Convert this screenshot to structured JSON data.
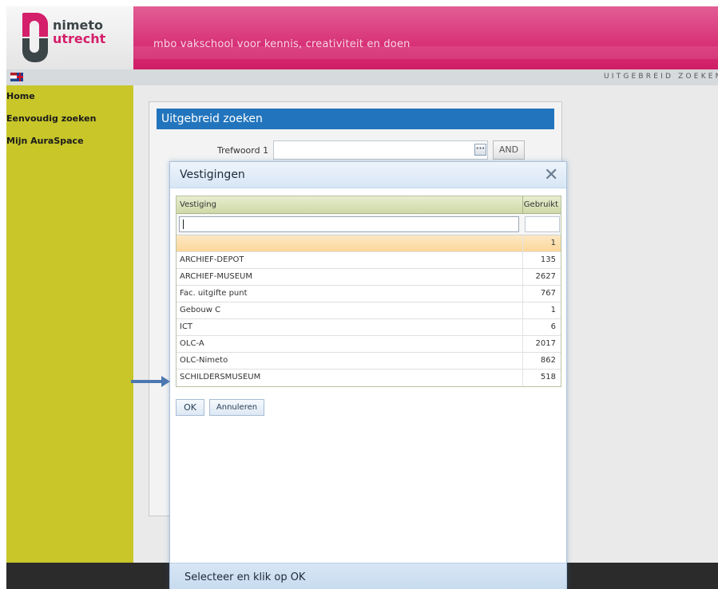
{
  "header": {
    "logo_line1": "nimeto",
    "logo_line2": "utrecht",
    "tagline": "mbo vakschool voor kennis, creativiteit en doen",
    "breadcrumb": "UITGEBREID ZOEKEN",
    "brand_color": "#d41f6a",
    "language_icon": "language-flag-icon"
  },
  "sidebar": {
    "items": [
      {
        "label": "Home"
      },
      {
        "label": "Eenvoudig zoeken"
      },
      {
        "label": "Mijn AuraSpace"
      }
    ],
    "color": "#c8c629"
  },
  "search_panel": {
    "title": "Uitgebreid zoeken",
    "trefwoord_label": "Trefwoord 1",
    "trefwoord_value": "",
    "more_label": "···",
    "operator_label": "AND"
  },
  "modal": {
    "title": "Vestigingen",
    "close_glyph": "✕",
    "columns": {
      "name": "Vestiging",
      "count": "Gebruikt"
    },
    "filter_value": "",
    "rows": [
      {
        "name": "",
        "count": "1"
      },
      {
        "name": "ARCHIEF-DEPOT",
        "count": "135"
      },
      {
        "name": "ARCHIEF-MUSEUM",
        "count": "2627"
      },
      {
        "name": "Fac. uitgifte punt",
        "count": "767"
      },
      {
        "name": "Gebouw C",
        "count": "1"
      },
      {
        "name": "ICT",
        "count": "6"
      },
      {
        "name": "OLC-A",
        "count": "2017"
      },
      {
        "name": "OLC-Nimeto",
        "count": "862"
      },
      {
        "name": "SCHILDERSMUSEUM",
        "count": "518"
      }
    ],
    "ok_label": "OK",
    "cancel_label": "Annuleren",
    "footer_text": "Selecteer en klik op OK"
  }
}
